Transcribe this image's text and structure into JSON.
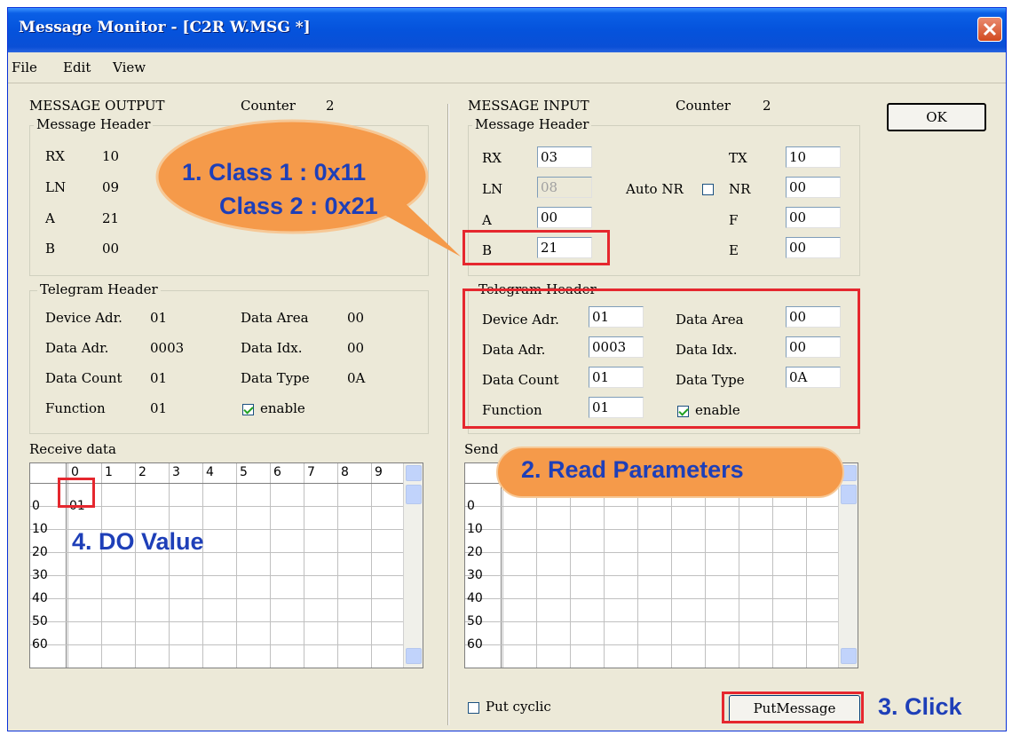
{
  "window": {
    "title": "Message Monitor - [C2R W.MSG *]"
  },
  "menu": [
    "File",
    "Edit",
    "View"
  ],
  "output": {
    "title": "MESSAGE OUTPUT",
    "counter_label": "Counter",
    "counter_value": "2",
    "header_title": "Message Header",
    "rx_label": "RX",
    "rx": "10",
    "ln_label": "LN",
    "ln": "09",
    "a_label": "A",
    "a": "21",
    "b_label": "B",
    "b": "00",
    "telegram_title": "Telegram Header",
    "device_adr_label": "Device Adr.",
    "device_adr": "01",
    "data_area_label": "Data Area",
    "data_area": "00",
    "data_adr_label": "Data Adr.",
    "data_adr": "0003",
    "data_idx_label": "Data Idx.",
    "data_idx": "00",
    "data_count_label": "Data Count",
    "data_count": "01",
    "data_type_label": "Data Type",
    "data_type": "0A",
    "function_label": "Function",
    "function": "01",
    "enable_label": "enable",
    "enable_checked": true,
    "receive_label": "Receive data"
  },
  "input": {
    "title": "MESSAGE INPUT",
    "counter_label": "Counter",
    "counter_value": "2",
    "header_title": "Message Header",
    "rx_label": "RX",
    "rx": "03",
    "ln_label": "LN",
    "ln": "08",
    "a_label": "A",
    "a": "00",
    "b_label": "B",
    "b": "21",
    "auto_nr_label": "Auto NR",
    "auto_nr_checked": false,
    "tx_label": "TX",
    "tx": "10",
    "nr_label": "NR",
    "nr": "00",
    "f_label": "F",
    "f": "00",
    "e_label": "E",
    "e": "00",
    "telegram_title": "Telegram Header",
    "device_adr_label": "Device Adr.",
    "device_adr": "01",
    "data_area_label": "Data Area",
    "data_area": "00",
    "data_adr_label": "Data Adr.",
    "data_adr": "0003",
    "data_idx_label": "Data Idx.",
    "data_idx": "00",
    "data_count_label": "Data Count",
    "data_count": "01",
    "data_type_label": "Data Type",
    "data_type": "0A",
    "function_label": "Function",
    "function": "01",
    "enable_label": "enable",
    "enable_checked": true,
    "send_label": "Send"
  },
  "receive_grid": {
    "col_headers": [
      "0",
      "1",
      "2",
      "3",
      "4",
      "5",
      "6",
      "7",
      "8",
      "9"
    ],
    "row_headers": [
      "0",
      "10",
      "20",
      "30",
      "40",
      "50",
      "60"
    ],
    "cell_0_0": "01"
  },
  "send_grid": {
    "row_headers": [
      "0",
      "10",
      "20",
      "30",
      "40",
      "50",
      "60"
    ]
  },
  "buttons": {
    "ok": "OK",
    "put_message": "PutMessage",
    "put_cyclic": "Put cyclic"
  },
  "annotations": {
    "class_line1": "1. Class 1 : 0x11",
    "class_line2": "Class 2 : 0x21",
    "read_params": "2. Read Parameters",
    "click": "3. Click",
    "do_value": "4. DO Value"
  },
  "colors": {
    "title_bar": "#0553dc",
    "annotation_bubble": "#f59a4a",
    "annotation_text": "#1e3fb8",
    "highlight": "#e5272e"
  }
}
